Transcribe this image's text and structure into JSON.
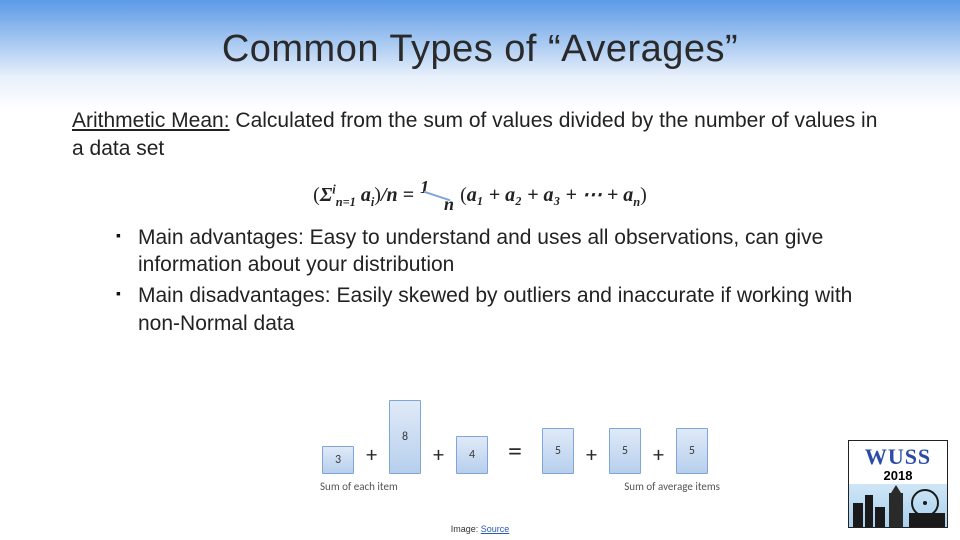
{
  "title": "Common Types of “Averages”",
  "section": {
    "label": "Arithmetic Mean:",
    "desc": " Calculated from the sum of values divided by the number of values in a data set"
  },
  "formula": {
    "lhs_open": "(",
    "sigma": "Σ",
    "sup": "i",
    "sub": "n=1",
    "var": " a",
    "var_sub": "i",
    "lhs_close": ")",
    "div_n": "/n",
    "eq": " = ",
    "frac_num": "1",
    "frac_den": "n",
    "rhs_open": " (",
    "terms": "a₁ + a₂ + a₃ + ⋯ + a",
    "last_sub": "n",
    "rhs_close": ")"
  },
  "bullets": [
    "Main advantages: Easy to understand and uses all observations, can give information about your distribution",
    "Main disadvantages: Easily skewed by outliers and inaccurate if working with non-Normal data"
  ],
  "chart_data": {
    "type": "bar",
    "left_label": "Sum of each item",
    "right_label": "Sum of average items",
    "left_values": [
      3,
      8,
      4
    ],
    "right_values": [
      5,
      5,
      5
    ],
    "plus": "+",
    "eq": "="
  },
  "credit": {
    "prefix": "Image:",
    "link": "Source"
  },
  "logo": {
    "name": "WUSS",
    "year": "2018"
  }
}
